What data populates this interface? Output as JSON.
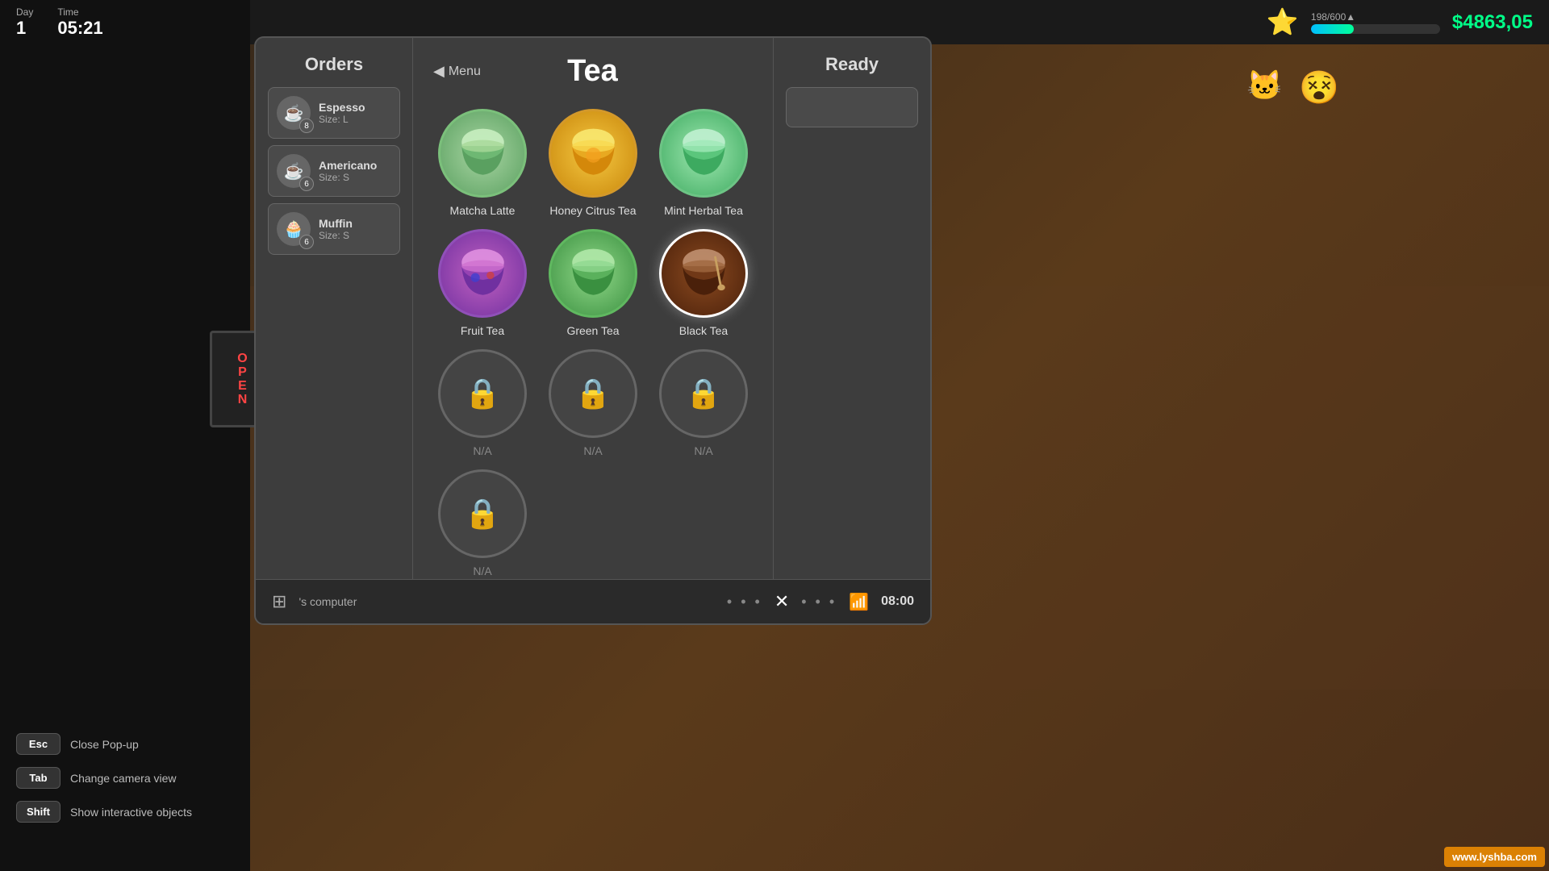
{
  "hud": {
    "day_label": "Day",
    "day_value": "1",
    "time_label": "Time",
    "time_value": "05:21",
    "xp_current": "198",
    "xp_max": "600",
    "xp_display": "198/600▲",
    "money": "$4863,05"
  },
  "orders": {
    "title": "Orders",
    "items": [
      {
        "name": "Espesso",
        "size": "Size: L",
        "count": "8",
        "emoji": "☕"
      },
      {
        "name": "Americano",
        "size": "Size: S",
        "count": "6",
        "emoji": "☕"
      },
      {
        "name": "Muffin",
        "size": "Size: S",
        "count": "6",
        "emoji": "🧁"
      }
    ]
  },
  "menu": {
    "back_label": "Menu",
    "title": "Tea",
    "items": [
      {
        "id": "matcha",
        "name": "Matcha Latte",
        "locked": false,
        "emoji": "🍵"
      },
      {
        "id": "honey",
        "name": "Honey Citrus Tea",
        "locked": false,
        "emoji": "🍊"
      },
      {
        "id": "mint",
        "name": "Mint Herbal Tea",
        "locked": false,
        "emoji": "🌿"
      },
      {
        "id": "fruit",
        "name": "Fruit Tea",
        "locked": false,
        "emoji": "🫐"
      },
      {
        "id": "green",
        "name": "Green Tea",
        "locked": false,
        "emoji": "🍃"
      },
      {
        "id": "black",
        "name": "Black Tea",
        "locked": false,
        "emoji": "🫖",
        "active": true
      },
      {
        "id": "locked1",
        "name": "N/A",
        "locked": true
      },
      {
        "id": "locked2",
        "name": "N/A",
        "locked": true
      },
      {
        "id": "locked3",
        "name": "N/A",
        "locked": true
      },
      {
        "id": "locked4",
        "name": "N/A",
        "locked": true
      }
    ]
  },
  "ready": {
    "title": "Ready"
  },
  "bottom_bar": {
    "computer_label": "'s computer",
    "time": "08:00",
    "close_label": "✕"
  },
  "keyboard_hints": [
    {
      "key": "Esc",
      "hint": "Close Pop-up"
    },
    {
      "key": "Tab",
      "hint": "Change camera view"
    },
    {
      "key": "Shift",
      "hint": "Show interactive objects"
    }
  ],
  "open_sign": "OPEN",
  "watermark": "www.lyshba.com"
}
